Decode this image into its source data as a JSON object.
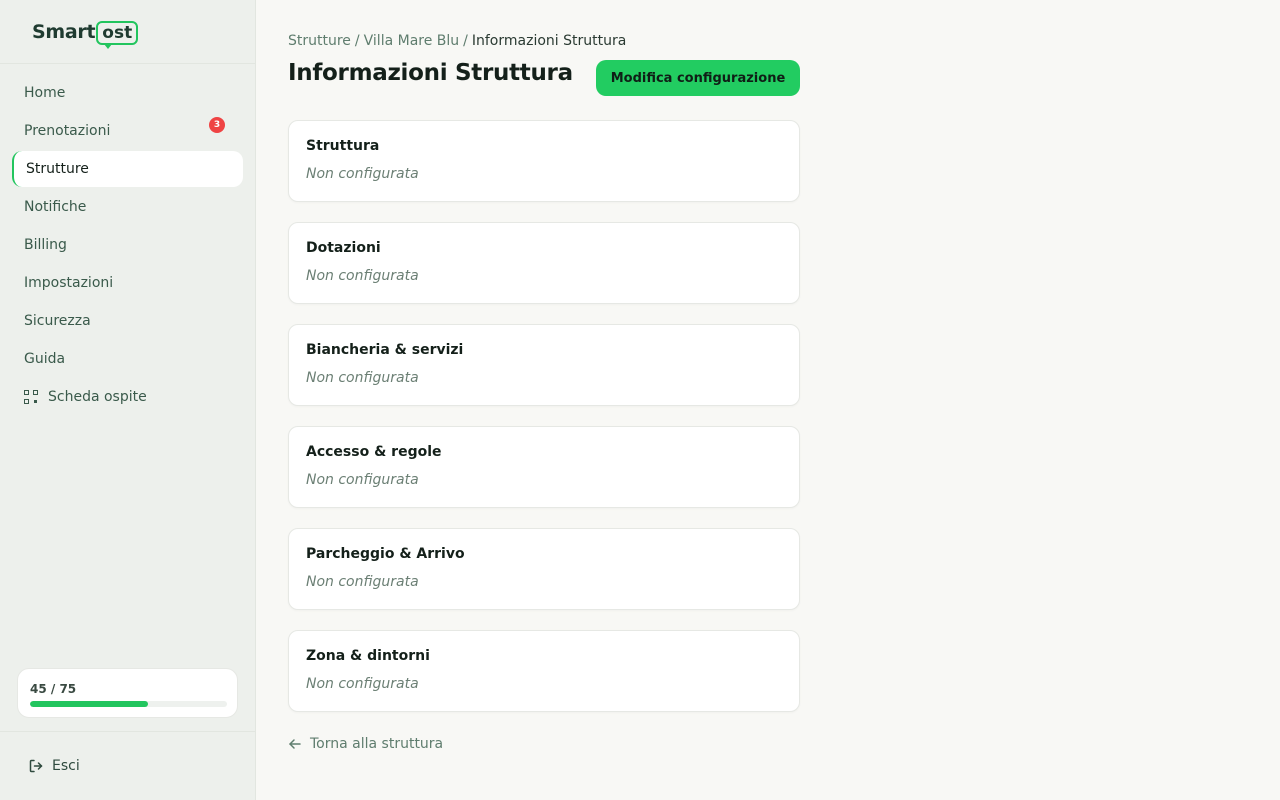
{
  "brand": {
    "name_prefix": "Smart",
    "name_bubble": "ost",
    "accent": "#22c55e"
  },
  "sidebar": {
    "items": [
      {
        "label": "Home"
      },
      {
        "label": "Prenotazioni"
      },
      {
        "label": "Strutture",
        "active": true
      },
      {
        "label": "Notifiche",
        "badge": "3"
      },
      {
        "label": "Billing"
      },
      {
        "label": "Impostazioni"
      },
      {
        "label": "Sicurezza"
      },
      {
        "label": "Guida"
      },
      {
        "label": "Scheda ospite",
        "icon": "qr-code-icon"
      }
    ],
    "quota": {
      "label": "45 / 75",
      "used": 45,
      "total": 75
    },
    "logout_label": "Esci"
  },
  "breadcrumb": {
    "items": [
      "Strutture",
      "Villa Mare Blu",
      "Informazioni Struttura"
    ],
    "separator": "/"
  },
  "page": {
    "title": "Informazioni Struttura",
    "edit_button": "Modifica configurazione"
  },
  "sections": [
    {
      "title": "Struttura",
      "status": "Non configurata"
    },
    {
      "title": "Dotazioni",
      "status": "Non configurata"
    },
    {
      "title": "Biancheria & servizi",
      "status": "Non configurata"
    },
    {
      "title": "Accesso & regole",
      "status": "Non configurata"
    },
    {
      "title": "Parcheggio & Arrivo",
      "status": "Non configurata"
    },
    {
      "title": "Zona & dintorni",
      "status": "Non configurata"
    }
  ],
  "back_link": "Torna alla struttura"
}
